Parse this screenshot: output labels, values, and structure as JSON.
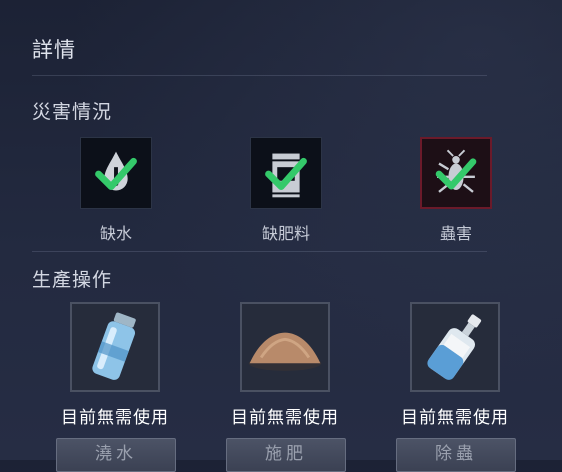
{
  "header": {
    "title": "詳情"
  },
  "disaster_section": {
    "title": "災害情況",
    "items": [
      {
        "label": "缺水",
        "icon": "water-drop-icon",
        "status": "ok"
      },
      {
        "label": "缺肥料",
        "icon": "fertilizer-bag-icon",
        "status": "ok"
      },
      {
        "label": "蟲害",
        "icon": "insect-icon",
        "status": "ok",
        "border_color": "#6b1a2a"
      }
    ]
  },
  "operation_section": {
    "title": "生產操作",
    "items": [
      {
        "status": "目前無需使用",
        "button": "澆水",
        "icon": "water-bottle-icon"
      },
      {
        "status": "目前無需使用",
        "button": "施肥",
        "icon": "fertilizer-pile-icon"
      },
      {
        "status": "目前無需使用",
        "button": "除蟲",
        "icon": "pesticide-bottle-icon"
      }
    ]
  },
  "colors": {
    "check": "#34c96a",
    "alert_border": "#6b1a2a"
  }
}
